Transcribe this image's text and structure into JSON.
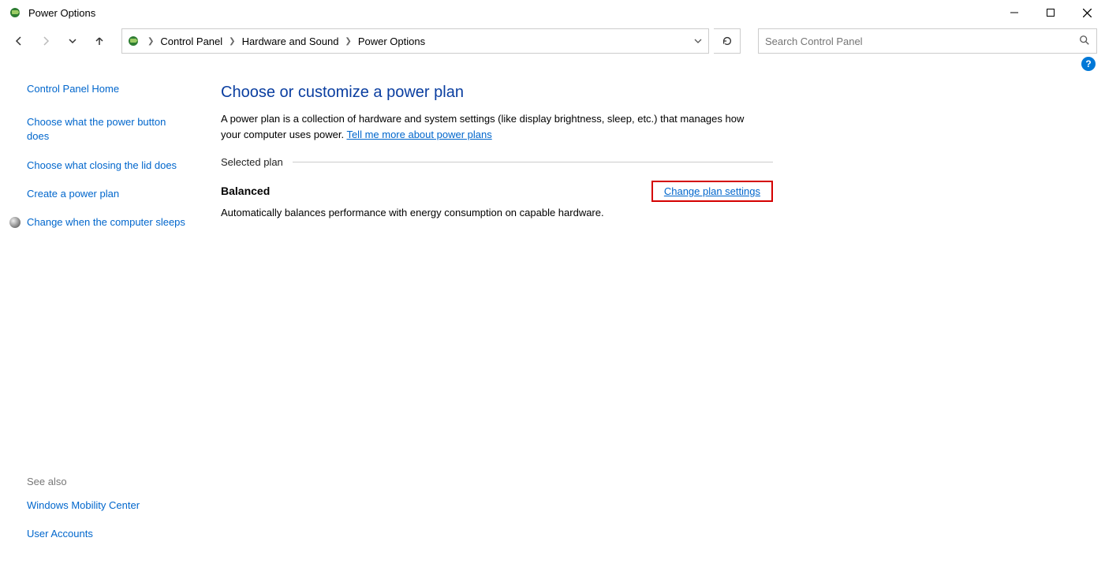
{
  "window": {
    "title": "Power Options"
  },
  "breadcrumbs": {
    "items": [
      "Control Panel",
      "Hardware and Sound",
      "Power Options"
    ]
  },
  "search": {
    "placeholder": "Search Control Panel"
  },
  "sidebar": {
    "home": "Control Panel Home",
    "links": [
      "Choose what the power button does",
      "Choose what closing the lid does",
      "Create a power plan",
      "Change when the computer sleeps"
    ],
    "see_also_label": "See also",
    "see_also": [
      "Windows Mobility Center",
      "User Accounts"
    ]
  },
  "main": {
    "heading": "Choose or customize a power plan",
    "description_pre": "A power plan is a collection of hardware and system settings (like display brightness, sleep, etc.) that manages how your computer uses power. ",
    "description_link": "Tell me more about power plans",
    "section_label": "Selected plan",
    "plan": {
      "name": "Balanced",
      "change_link": "Change plan settings",
      "description": "Automatically balances performance with energy consumption on capable hardware."
    }
  }
}
